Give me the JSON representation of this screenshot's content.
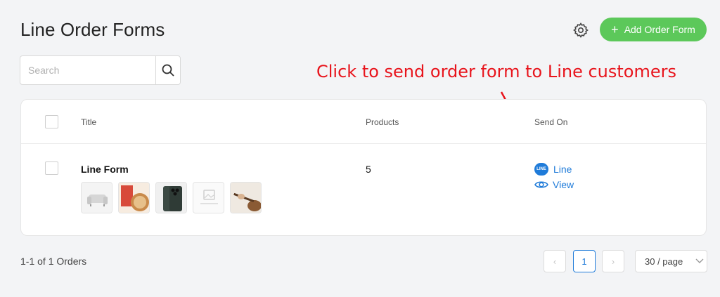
{
  "page": {
    "title": "Line Order Forms"
  },
  "toolbar": {
    "settings_icon": "gear-icon",
    "add_label": "Add Order Form",
    "add_color": "#5cc85a"
  },
  "search": {
    "placeholder": "Search",
    "value": ""
  },
  "annotation": {
    "text": "Click to send order form to Line customers",
    "color": "#e8141c"
  },
  "table": {
    "columns": [
      "Title",
      "Products",
      "Send On"
    ],
    "rows": [
      {
        "title": "Line Form",
        "products": "5",
        "thumbnails": [
          "sofa",
          "coffee",
          "phone",
          "no-image",
          "guitar"
        ],
        "send_on": {
          "channel": "Line",
          "badge": "LINE",
          "view": "View"
        }
      }
    ]
  },
  "footer": {
    "summary": "1-1 of 1 Orders",
    "current_page": "1",
    "page_size": "30 / page"
  },
  "colors": {
    "link": "#1f7bd9",
    "primary": "#5cc85a"
  }
}
